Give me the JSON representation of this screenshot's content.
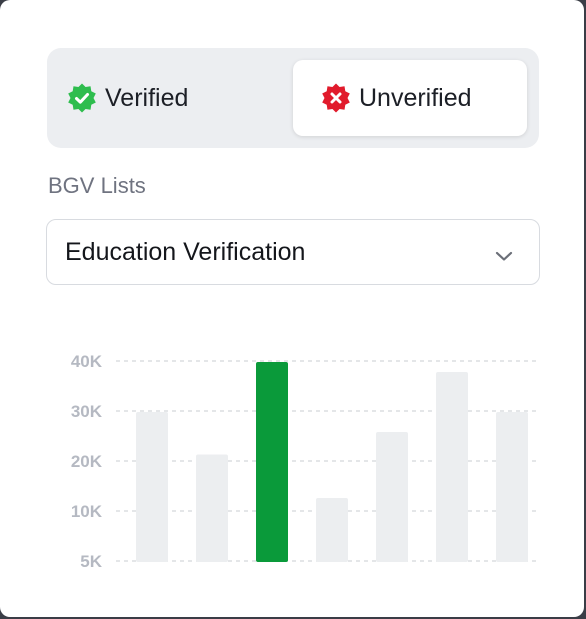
{
  "toggle": {
    "verified_label": "Verified",
    "unverified_label": "Unverified",
    "selected": "Unverified",
    "verified_icon": "verified-badge-icon",
    "unverified_icon": "unverified-badge-icon",
    "verified_color": "#2ebd4e",
    "unverified_color": "#e11b2c"
  },
  "bgv": {
    "label": "BGV Lists",
    "selected": "Education Verification",
    "chevron_icon": "chevron-down-icon"
  },
  "colors": {
    "highlight_bar": "#0a9a3a",
    "default_bar": "#eceef0",
    "gridline": "#d3d6db",
    "tick_text": "#b5b9c2"
  },
  "chart_data": {
    "type": "bar",
    "title": "",
    "xlabel": "",
    "ylabel": "",
    "y_tick_labels": [
      "40K",
      "30K",
      "20K",
      "10K",
      "5K"
    ],
    "y_tick_values": [
      40000,
      30000,
      20000,
      10000,
      5000
    ],
    "categories": [
      "",
      "",
      "",
      "",
      "",
      "",
      ""
    ],
    "values": [
      29800,
      21300,
      39800,
      12600,
      25800,
      37800,
      29800
    ],
    "highlight_index": 2,
    "grid": true,
    "gridline_style": "dashed",
    "legend": "none"
  }
}
